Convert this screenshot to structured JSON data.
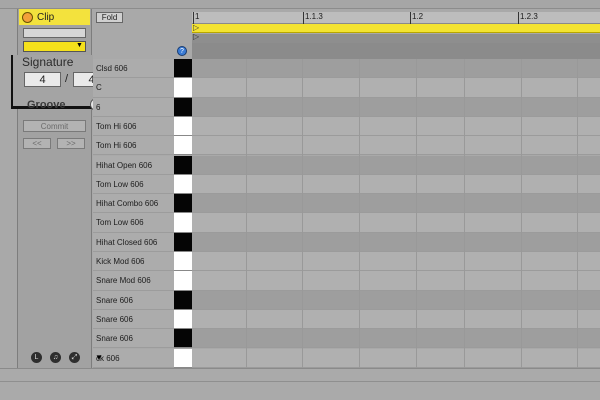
{
  "clip_panel": {
    "title": "Clip",
    "signature_label": "Signature",
    "signature_numerator": "4",
    "signature_separator": "/",
    "signature_denominator": "4",
    "groove_label": "Groove",
    "groove_icon_glyph": "◉",
    "commit_label": "Commit",
    "nudge_left_label": "<<",
    "nudge_right_label": ">>",
    "color_dropdown_arrow": "▼",
    "bottom_icons": [
      "L",
      "♫",
      "⤢"
    ]
  },
  "drum_rack": {
    "fold_label": "Fold",
    "fold_marker_glyph": "?",
    "scroll_arrow": "▼",
    "key_names": [
      "Clsd 606",
      "C",
      "6",
      "Tom Hi 606",
      "Tom Hi 606",
      "Hihat Open 606",
      "Tom Low 606",
      "Hihat Combo 606",
      "Tom Low 606",
      "Hihat Closed 606",
      "Kick Mod 606",
      "Snare Mod 606",
      "Snare 606",
      "Snare 606",
      "Snare 606",
      "ck 606"
    ],
    "piano_keys": [
      "black",
      "white",
      "black",
      "white",
      "white",
      "black",
      "white",
      "black",
      "white",
      "black",
      "white",
      "white",
      "black",
      "white",
      "black",
      "white"
    ]
  },
  "timeline": {
    "markers": [
      {
        "label": "1"
      },
      {
        "label": "1.1.3"
      },
      {
        "label": "1.2"
      },
      {
        "label": "1.2.3"
      }
    ],
    "loop_flag": "▷"
  },
  "colors": {
    "clip_yellow": "#f3e23d",
    "loop_yellow": "#f3e331",
    "led_orange": "#f2a03a",
    "fold_marker_blue": "#3a7bd5"
  }
}
